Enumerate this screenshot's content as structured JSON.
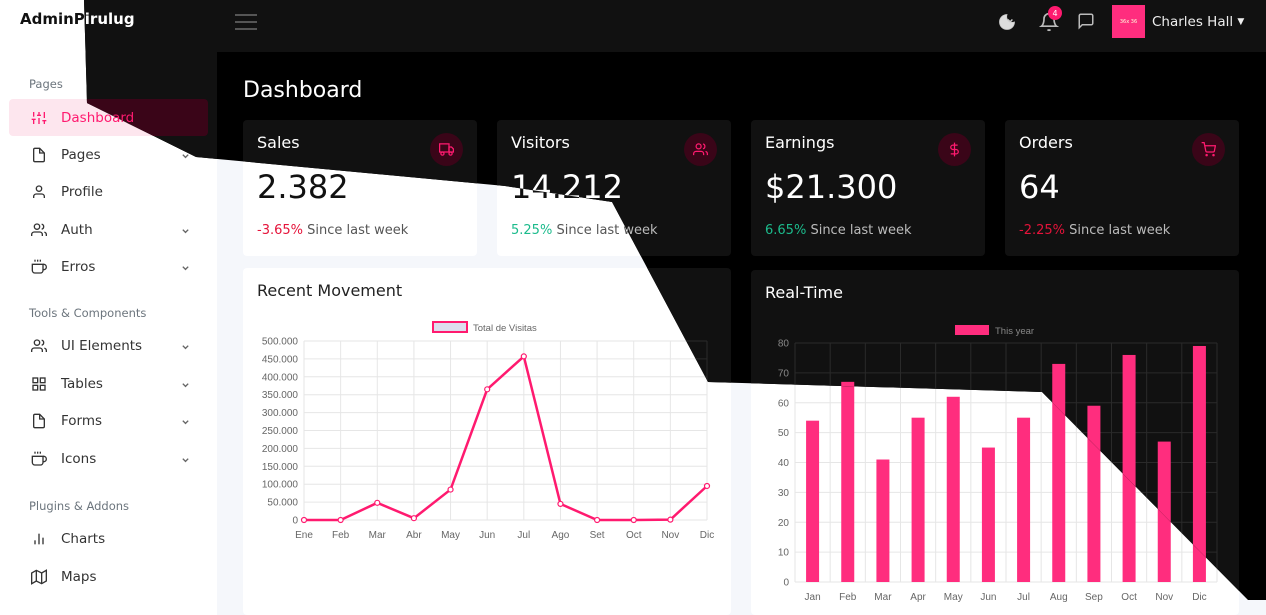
{
  "brand": "AdminPirulug",
  "sidebar": {
    "headers": [
      "Pages",
      "Tools & Components",
      "Plugins & Addons"
    ],
    "items": [
      {
        "label": "Dashboard",
        "icon": "sliders-icon",
        "active": true
      },
      {
        "label": "Pages",
        "icon": "file-icon",
        "chevron": true
      },
      {
        "label": "Profile",
        "icon": "user-icon"
      },
      {
        "label": "Auth",
        "icon": "users-icon",
        "chevron": true
      },
      {
        "label": "Erros",
        "icon": "coffee-icon",
        "chevron": true
      },
      {
        "label": "UI Elements",
        "icon": "users-icon",
        "chevron": true
      },
      {
        "label": "Tables",
        "icon": "grid-icon",
        "chevron": true
      },
      {
        "label": "Forms",
        "icon": "file-icon",
        "chevron": true
      },
      {
        "label": "Icons",
        "icon": "coffee-icon",
        "chevron": true
      },
      {
        "label": "Charts",
        "icon": "bar-chart-icon"
      },
      {
        "label": "Maps",
        "icon": "map-icon"
      }
    ]
  },
  "topbar": {
    "notifications": "4",
    "avatar_text": "36x 36",
    "username": "Charles Hall"
  },
  "page_title": "Dashboard",
  "stats": [
    {
      "title": "Sales",
      "value": "2.382",
      "change": "-3.65%",
      "direction": "neg",
      "since": "Since last week",
      "icon": "truck-icon"
    },
    {
      "title": "Visitors",
      "value": "14.212",
      "change": "5.25%",
      "direction": "pos",
      "since": "Since last week",
      "icon": "users-icon"
    },
    {
      "title": "Earnings",
      "value": "$21.300",
      "change": "6.65%",
      "direction": "pos",
      "since": "Since last week",
      "icon": "dollar-icon"
    },
    {
      "title": "Orders",
      "value": "64",
      "change": "-2.25%",
      "direction": "neg",
      "since": "Since last week",
      "icon": "cart-icon"
    }
  ],
  "colors": {
    "accent": "#ff1a6f",
    "bar": "#ff2d7e",
    "neg": "#e5133a",
    "pos": "#1cbb8c"
  },
  "chart_data": [
    {
      "type": "line",
      "title": "Recent Movement",
      "series": [
        {
          "name": "Total de Visitas",
          "values": [
            0,
            0,
            48000,
            5000,
            85000,
            365000,
            457000,
            45000,
            0,
            0,
            1000,
            95000
          ]
        }
      ],
      "categories": [
        "Ene",
        "Feb",
        "Mar",
        "Abr",
        "May",
        "Jun",
        "Jul",
        "Ago",
        "Set",
        "Oct",
        "Nov",
        "Dic"
      ],
      "yticks": [
        "0",
        "50.000",
        "100.000",
        "150.000",
        "200.000",
        "250.000",
        "300.000",
        "350.000",
        "400.000",
        "450.000",
        "500.000"
      ],
      "ylim": [
        0,
        500000
      ],
      "grid": true
    },
    {
      "type": "bar",
      "title": "Real-Time",
      "series": [
        {
          "name": "This year",
          "values": [
            54,
            67,
            41,
            55,
            62,
            45,
            55,
            73,
            59,
            76,
            47,
            79
          ]
        }
      ],
      "categories": [
        "Jan",
        "Feb",
        "Mar",
        "Apr",
        "May",
        "Jun",
        "Jul",
        "Aug",
        "Sep",
        "Oct",
        "Nov",
        "Dic"
      ],
      "yticks": [
        "0",
        "10",
        "20",
        "30",
        "40",
        "50",
        "60",
        "70",
        "80"
      ],
      "ylim": [
        0,
        80
      ],
      "grid": true
    }
  ]
}
